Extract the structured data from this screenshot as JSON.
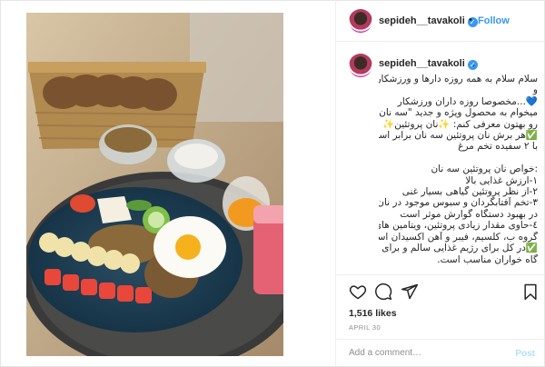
{
  "post": {
    "username": "sepideh__tavakoli",
    "verified_icon": "verified-badge-icon",
    "follow_separator": "•",
    "follow_label": "Follow",
    "caption_user_trail": ".",
    "caption_lines": [
      "سلام سلام به همه روزه دارها و ورزشکارها",
      "و",
      "💙...مخصوصا روزه داران ورزشکار",
      "میخوام به محصول ویژه و جدید \"سه نان\"",
      "رو بهتون معرفی کنم: ✨نان پروتئین✨",
      "✅هر برش نان پروتئین سه نان برابر است",
      "با ۲ سفیده تخم مرغ",
      "",
      ":خواص نان پروتئین سه نان",
      "۱-ارزش غذایی بالا",
      "۲-از نظر پروتئین گیاهی بسیار غنی",
      "۳-تخم آفتابگردان و سبوس موجود در نان",
      "در بهبود دستگاه گوارش موثر است",
      "٤-حاوی مقدار زیادی پروتئین، ویتامین های",
      "گروه ب، کلسیم، فیبر و آهن اکسیدان است.",
      "✅در کل برای رژیم غذایی سالم و برای",
      "گاه خواران مناسب است."
    ],
    "likes": "1,516 likes",
    "date": "APRIL 30",
    "comment_placeholder": "Add a comment…",
    "post_label": "Post"
  },
  "icons": {
    "like": "heart-icon",
    "comment": "comment-bubble-icon",
    "share": "paper-plane-icon",
    "save": "bookmark-icon"
  },
  "colors": {
    "link_blue": "#3897f0",
    "post_disabled": "#b2dffc",
    "meta_gray": "#8e8e8e",
    "border": "#efefef"
  }
}
